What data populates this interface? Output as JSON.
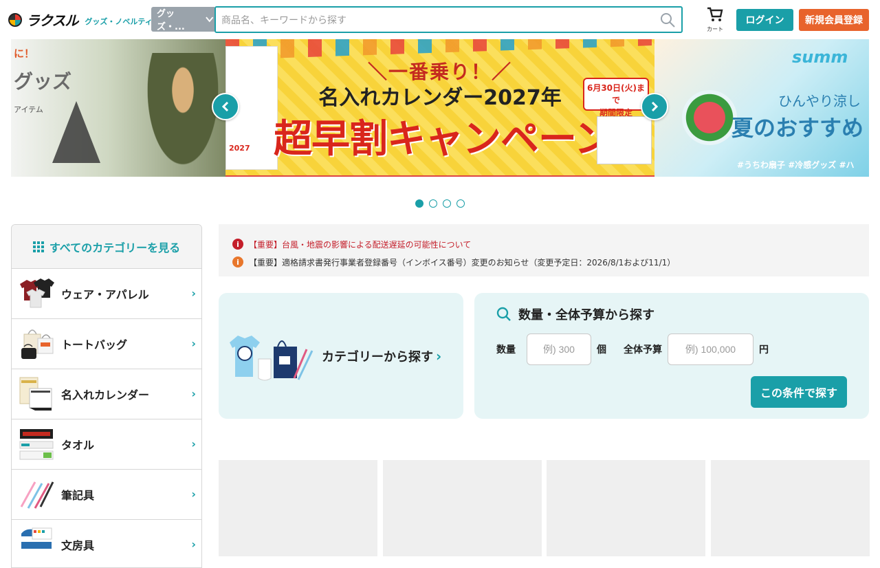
{
  "header": {
    "logo_text": "ラクスル",
    "logo_sub": "グッズ・ノベルティ",
    "search_category": "グッズ・...",
    "search_placeholder": "商品名、キーワードから探す",
    "cart_label": "カート",
    "login": "ログイン",
    "register": "新規会員登録"
  },
  "carousel": {
    "left": {
      "tag": "に！",
      "title": "グッズ",
      "sub": "アイテム"
    },
    "main": {
      "line1": "＼一番乗り！／",
      "line2": "名入れカレンダー2027年",
      "line3": "超早割キャンペーン",
      "badge_line1": "6月30日(火)まで",
      "badge_line2": "期間限定",
      "calendar_text": "2027"
    },
    "right": {
      "title": "summ",
      "line1": "ひんやり涼し",
      "line2": "夏のおすすめ",
      "hashtags": "#うちわ扇子 #冷感グッズ #ハ"
    },
    "prev_arrow": "‹",
    "next_arrow": "›",
    "active_dot": 0,
    "dot_count": 4
  },
  "sidebar": {
    "header": "すべてのカテゴリーを見る",
    "items": [
      {
        "label": "ウェア・アパレル"
      },
      {
        "label": "トートバッグ"
      },
      {
        "label": "名入れカレンダー"
      },
      {
        "label": "タオル"
      },
      {
        "label": "筆記具"
      },
      {
        "label": "文房具"
      }
    ]
  },
  "notices": [
    {
      "text": "【重要】台風・地震の影響による配送遅延の可能性について",
      "color": "#c41e2a"
    },
    {
      "text": "【重要】適格請求書発行事業者登録番号（インボイス番号）変更のお知らせ（変更予定日：2026/8/1および11/1）",
      "color": "#e8772c"
    }
  ],
  "category_panel": {
    "label": "カテゴリーから探す"
  },
  "budget_panel": {
    "title": "数量・全体予算から探す",
    "qty_label": "数量",
    "qty_placeholder": "例) 300",
    "qty_unit": "個",
    "budget_label": "全体予算",
    "budget_placeholder": "例) 100,000",
    "budget_unit": "円",
    "search_button": "この条件で探す"
  },
  "colors": {
    "accent": "#1a9fa8",
    "register": "#e8632c",
    "alert_red": "#c41e2a",
    "alert_orange": "#e8772c"
  }
}
